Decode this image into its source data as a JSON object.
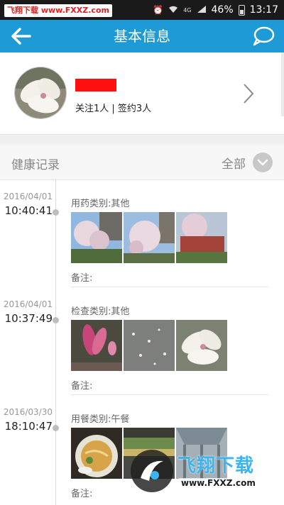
{
  "status_bar": {
    "watermark": "飞翔下载 www.FXXZ.com",
    "network": "4G",
    "battery": "46%",
    "time": "13:17"
  },
  "appbar": {
    "title": "基本信息",
    "back_icon": "arrow-left-icon",
    "chat_icon": "chat-bubble-icon",
    "color": "#1e9ad6"
  },
  "profile": {
    "follow_text": "关注1人 | 签约3人",
    "name_redacted_color": "#ff1010"
  },
  "section": {
    "title": "健康记录",
    "filter_label": "全部"
  },
  "records": [
    {
      "date": "2016/04/01",
      "time": "10:40:41",
      "type": "用药类别:其他",
      "photos": [
        "magnolia-tree-photo",
        "magnolia-blossom-photo",
        "magnolia-building-photo"
      ],
      "note": "备注:"
    },
    {
      "date": "2016/04/01",
      "time": "10:37:49",
      "type": "检查类别:其他",
      "photos": [
        "pink-magnolia-photo",
        "petals-ground-photo",
        "white-magnolia-photo"
      ],
      "note": "备注:"
    },
    {
      "date": "2016/03/30",
      "time": "18:10:47",
      "type": "用餐类别:午餐",
      "photos": [
        "noodle-bowl-photo",
        "market-stall-photo",
        "hall-interior-photo"
      ],
      "note": "备注:"
    }
  ],
  "footer_watermark": {
    "text": "飞翔下载",
    "url": "www.FXXZ.com"
  }
}
